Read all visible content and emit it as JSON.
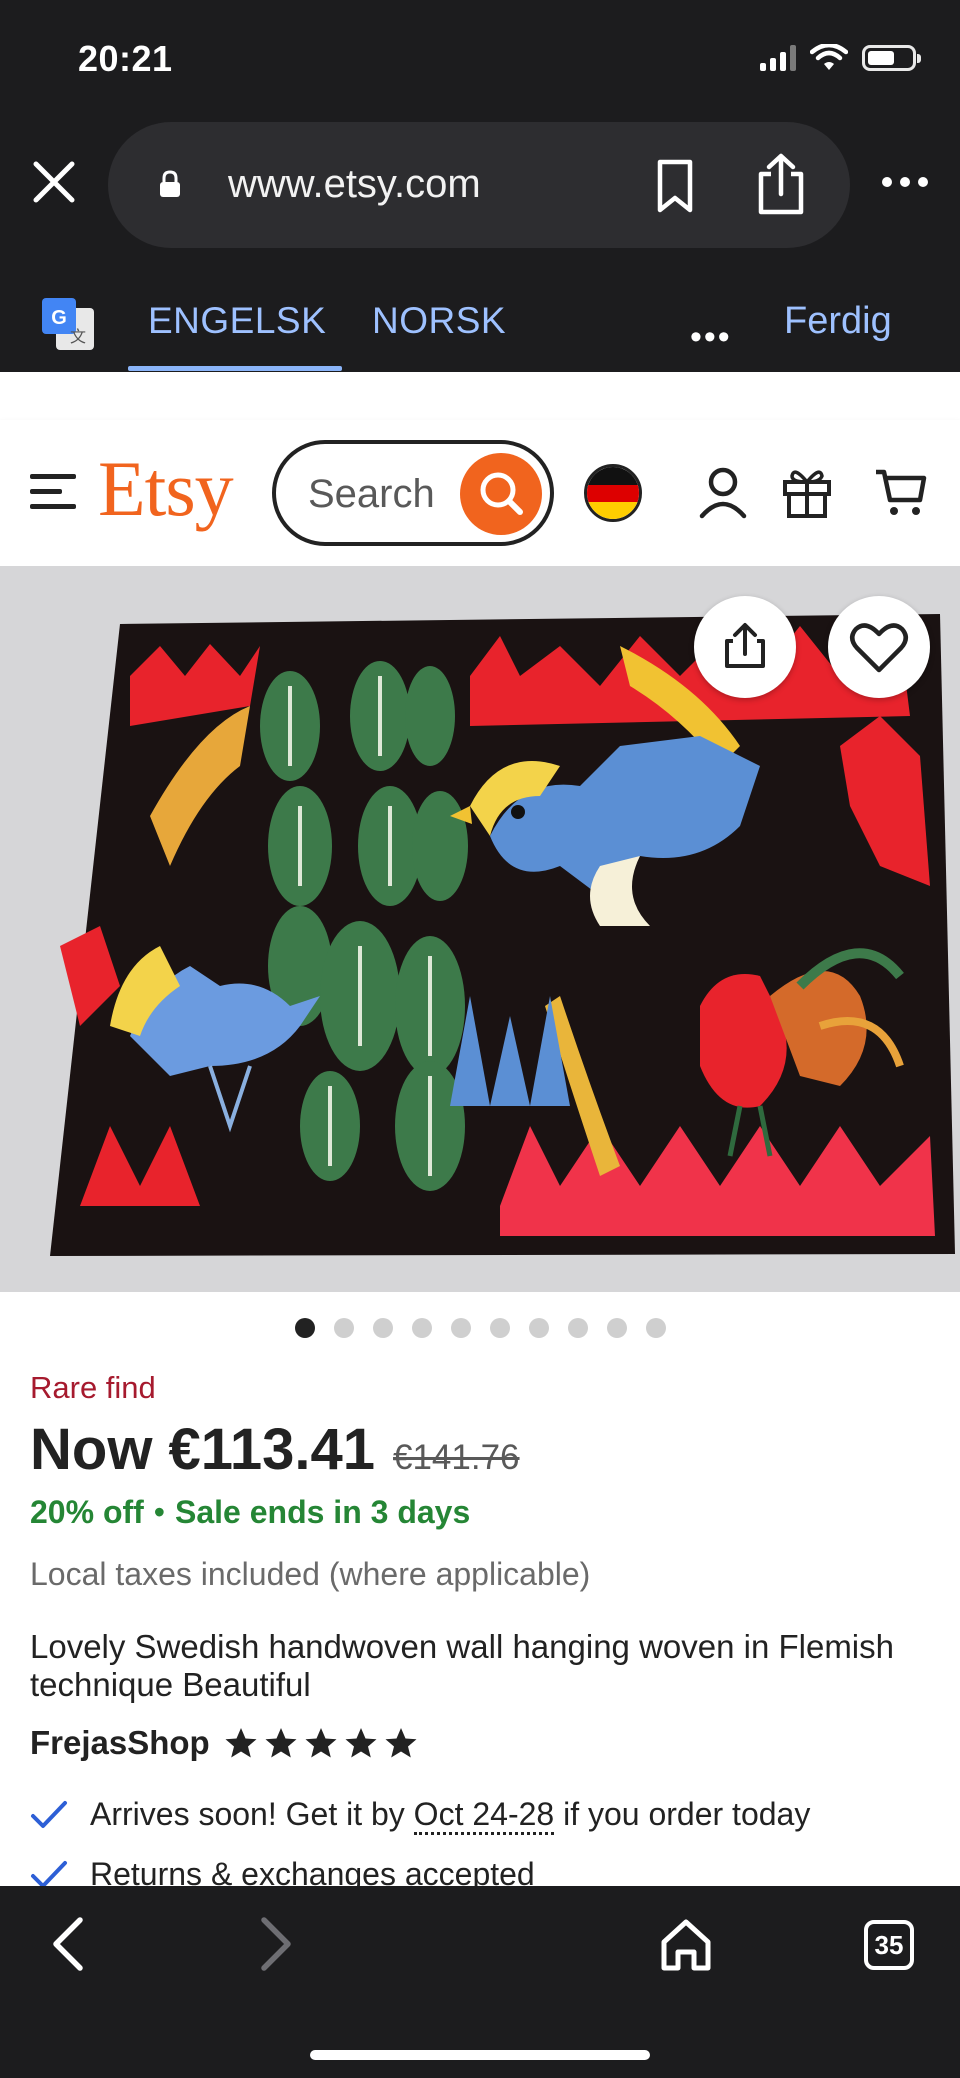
{
  "status_bar": {
    "time": "20:21"
  },
  "browser": {
    "url": "www.etsy.com",
    "tabs_count": "35"
  },
  "translate_bar": {
    "active_language": "ENGELSK",
    "other_language": "NORSK",
    "more": "•••",
    "done": "Ferdig"
  },
  "etsy_header": {
    "logo": "Etsy",
    "search_placeholder": "Search"
  },
  "gallery": {
    "image_count": 10,
    "active_index": 0
  },
  "product": {
    "badge": "Rare find",
    "price_now": "Now €113.41",
    "price_original": "€141.76",
    "discount": "20% off",
    "sale_ends": "Sale ends in 3 days",
    "taxes_note": "Local taxes included (where applicable)",
    "title": "Lovely Swedish handwoven wall hanging woven in Flemish technique Beautiful",
    "shop_name": "FrejasShop",
    "rating_stars": 5,
    "arrival_prefix": "Arrives soon! Get it by ",
    "arrival_dates": "Oct 24-28",
    "arrival_suffix": " if you order today",
    "returns": "Returns & exchanges accepted"
  },
  "colors": {
    "etsy_orange": "#f1641e",
    "sale_green": "#258635",
    "rare_red": "#a61a2e",
    "chrome_dark": "#1c1c1e",
    "translate_blue": "#9ec1ff"
  }
}
